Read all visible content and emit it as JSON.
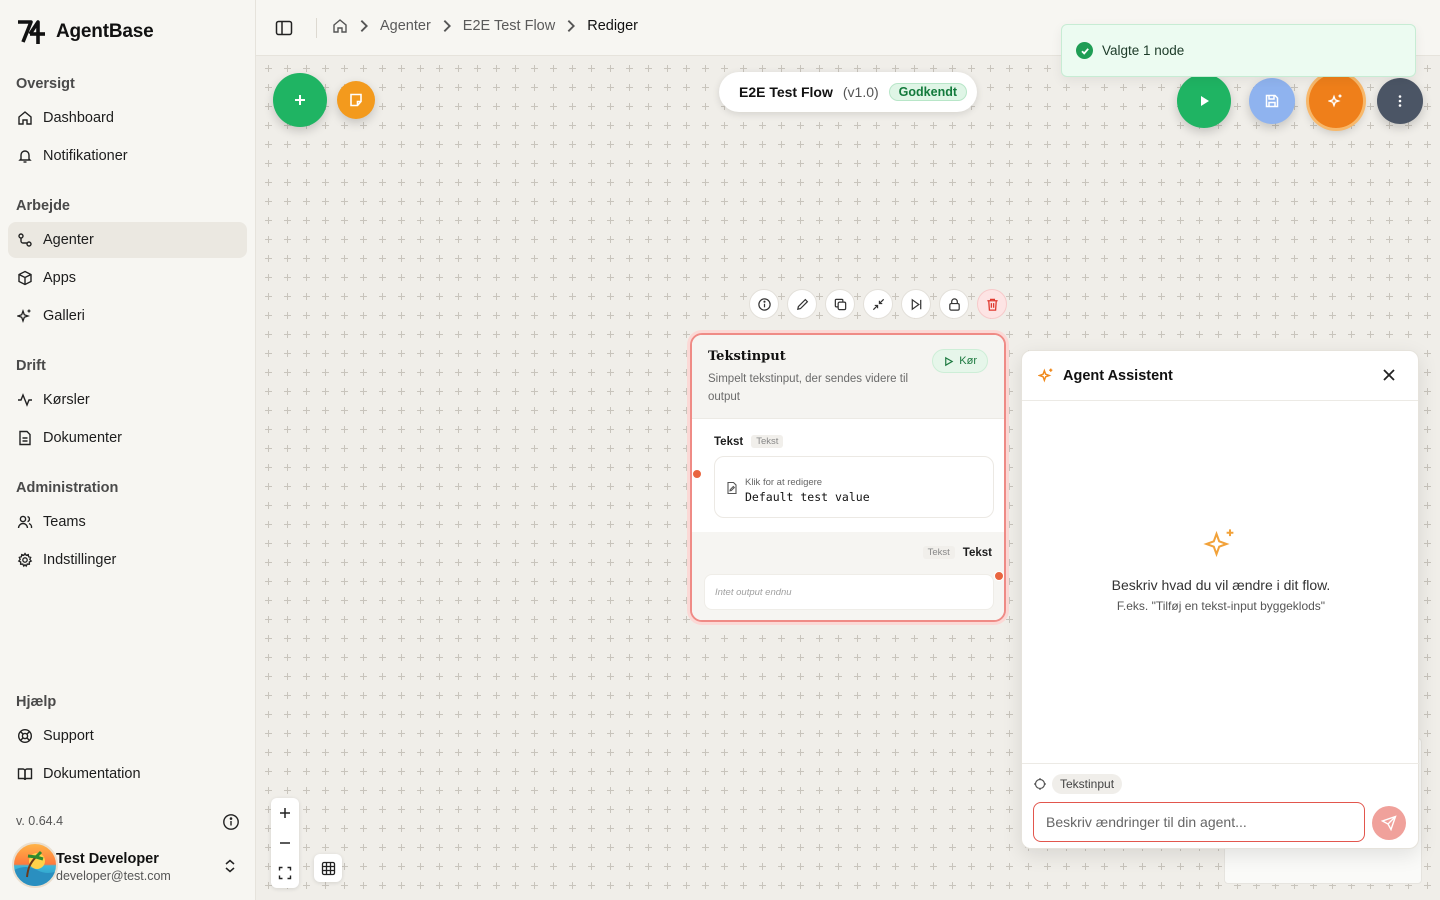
{
  "app": {
    "name": "AgentBase"
  },
  "sidebar": {
    "sections": [
      {
        "title": "Oversigt",
        "items": [
          {
            "label": "Dashboard",
            "icon": "home-icon"
          },
          {
            "label": "Notifikationer",
            "icon": "bell-icon"
          }
        ]
      },
      {
        "title": "Arbejde",
        "items": [
          {
            "label": "Agenter",
            "icon": "workflow-icon",
            "active": true
          },
          {
            "label": "Apps",
            "icon": "box-icon"
          },
          {
            "label": "Galleri",
            "icon": "sparkles-icon"
          }
        ]
      },
      {
        "title": "Drift",
        "items": [
          {
            "label": "Kørsler",
            "icon": "activity-icon"
          },
          {
            "label": "Dokumenter",
            "icon": "document-icon"
          }
        ]
      },
      {
        "title": "Administration",
        "items": [
          {
            "label": "Teams",
            "icon": "users-icon"
          },
          {
            "label": "Indstillinger",
            "icon": "gear-icon"
          }
        ]
      },
      {
        "title": "Hjælp",
        "items": [
          {
            "label": "Support",
            "icon": "lifebuoy-icon"
          },
          {
            "label": "Dokumentation",
            "icon": "book-icon"
          }
        ]
      }
    ],
    "version": "v. 0.64.4",
    "user": {
      "name": "Test Developer",
      "email": "developer@test.com"
    }
  },
  "breadcrumb": {
    "items": [
      "Agenter",
      "E2E Test Flow"
    ],
    "current": "Rediger"
  },
  "flow": {
    "name": "E2E Test Flow",
    "version": "(v1.0)",
    "status": "Godkendt"
  },
  "toast": {
    "message": "Valgte 1 node"
  },
  "node": {
    "title": "Tekstinput",
    "description": "Simpelt tekstinput, der sendes videre til output",
    "run_label": "Kør",
    "input": {
      "label": "Tekst",
      "type_tag": "Tekst",
      "hint": "Klik for at redigere",
      "value": "Default test value"
    },
    "output": {
      "label": "Tekst",
      "type_tag": "Tekst",
      "empty_text": "Intet output endnu"
    }
  },
  "assistant": {
    "title": "Agent Assistent",
    "empty_title": "Beskriv hvad du vil ændre i dit flow.",
    "empty_sub": "F.eks. \"Tilføj en tekst-input byggeklods\"",
    "context_chip": "Tekstinput",
    "input_placeholder": "Beskriv ændringer til din agent..."
  },
  "colors": {
    "accent_green": "#1fb463",
    "accent_orange": "#f08a1e",
    "danger": "#e2564d",
    "save_blue": "#7fa6e8",
    "more_slate": "#4b5565"
  }
}
